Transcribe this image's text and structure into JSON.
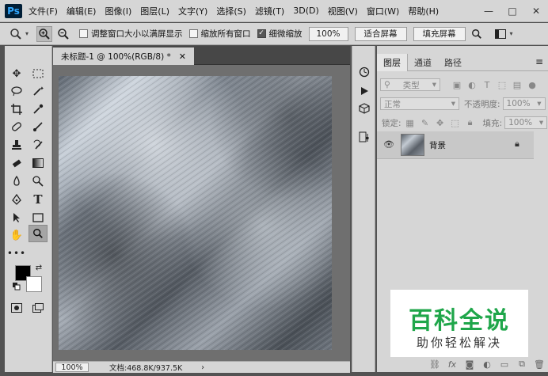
{
  "app": {
    "logo": "Ps"
  },
  "menu": [
    "文件(F)",
    "编辑(E)",
    "图像(I)",
    "图层(L)",
    "文字(Y)",
    "选择(S)",
    "滤镜(T)",
    "3D(D)",
    "视图(V)",
    "窗口(W)",
    "帮助(H)"
  ],
  "window_controls": {
    "minimize": "—",
    "maximize": "□",
    "close": "✕"
  },
  "options": {
    "resize_windows_label": "调整窗口大小以满屏显示",
    "zoom_all_label": "缩放所有窗口",
    "scrubby_zoom_label": "细微缩放",
    "zoom_value": "100%",
    "fit_screen": "适合屏幕",
    "fill_screen": "填充屏幕"
  },
  "document": {
    "tab_title": "未标题-1 @ 100%(RGB/8) *",
    "status_zoom": "100%",
    "status_info": "文档:468.8K/937.5K",
    "status_arrow": "›"
  },
  "layers_panel": {
    "tabs": [
      "图层",
      "通道",
      "路径"
    ],
    "filter_kind": "类型",
    "blend_mode": "正常",
    "opacity_label": "不透明度:",
    "opacity_value": "100%",
    "lock_label": "锁定:",
    "fill_label": "填充:",
    "fill_value": "100%",
    "layer_name": "背景"
  },
  "watermark": {
    "title": "百科全说",
    "subtitle": "助你轻松解决"
  },
  "colors": {
    "accent": "#1fa64a",
    "fg": "#000000",
    "bg": "#ffffff",
    "ui": "#d6d6d6"
  }
}
